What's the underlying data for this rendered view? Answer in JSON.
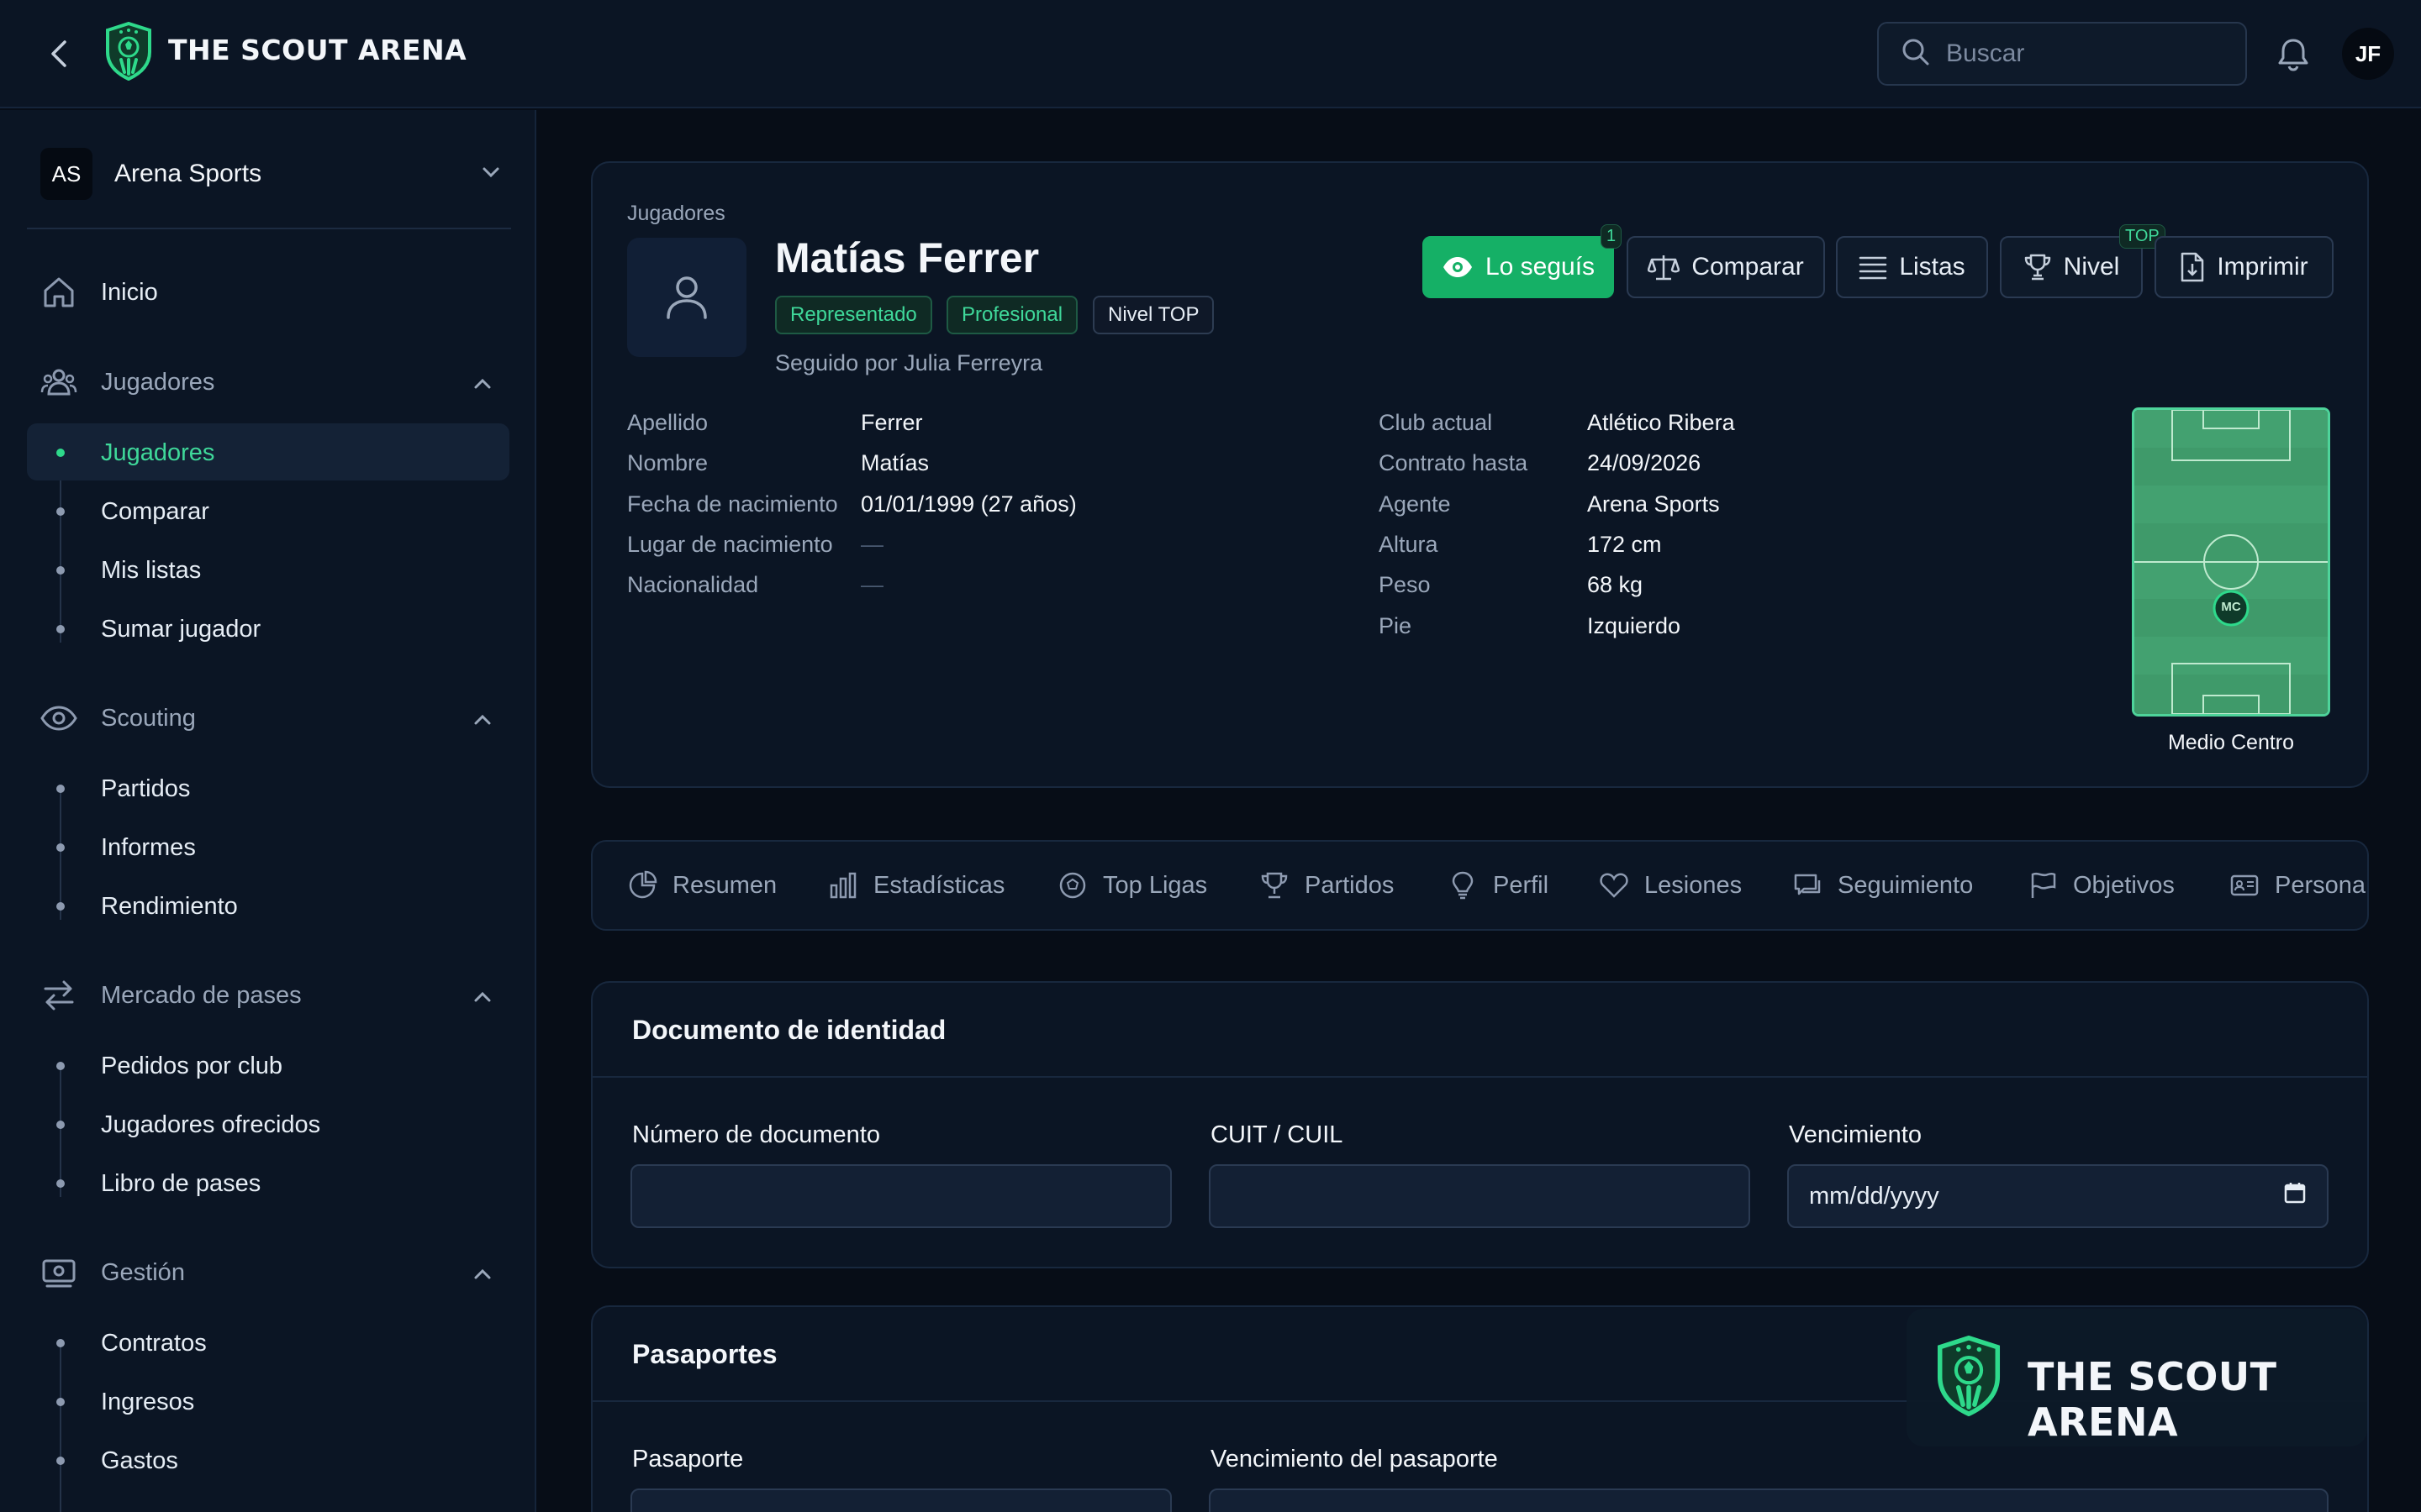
{
  "app": {
    "brand": "THE SCOUT ARENA"
  },
  "header": {
    "search_placeholder": "Buscar",
    "user_initials": "JF"
  },
  "sidebar": {
    "org": {
      "initials": "AS",
      "name": "Arena Sports"
    },
    "home": "Inicio",
    "sections": [
      {
        "label": "Jugadores",
        "items": [
          "Jugadores",
          "Comparar",
          "Mis listas",
          "Sumar jugador"
        ]
      },
      {
        "label": "Scouting",
        "items": [
          "Partidos",
          "Informes",
          "Rendimiento"
        ]
      },
      {
        "label": "Mercado de pases",
        "items": [
          "Pedidos por club",
          "Jugadores ofrecidos",
          "Libro de pases"
        ]
      },
      {
        "label": "Gestión",
        "items": [
          "Contratos",
          "Ingresos",
          "Gastos"
        ]
      }
    ],
    "active_item": "Jugadores"
  },
  "player": {
    "breadcrumb": "Jugadores",
    "name": "Matías Ferrer",
    "tags": [
      "Representado",
      "Profesional",
      "Nivel TOP"
    ],
    "followed_by": "Seguido por Julia Ferreyra",
    "actions": {
      "follow": "Lo seguís",
      "follow_count": "1",
      "compare": "Comparar",
      "lists": "Listas",
      "level": "Nivel",
      "level_badge": "TOP",
      "print": "Imprimir"
    },
    "left_fields": [
      {
        "label": "Apellido",
        "value": "Ferrer"
      },
      {
        "label": "Nombre",
        "value": "Matías"
      },
      {
        "label": "Fecha de nacimiento",
        "value": "01/01/1999 (27 años)"
      },
      {
        "label": "Lugar de nacimiento",
        "value": "—"
      },
      {
        "label": "Nacionalidad",
        "value": "—"
      }
    ],
    "right_fields": [
      {
        "label": "Club actual",
        "value": "Atlético Ribera"
      },
      {
        "label": "Contrato hasta",
        "value": "24/09/2026"
      },
      {
        "label": "Agente",
        "value": "Arena Sports"
      },
      {
        "label": "Altura",
        "value": "172 cm"
      },
      {
        "label": "Peso",
        "value": "68 kg"
      },
      {
        "label": "Pie",
        "value": "Izquierdo"
      }
    ],
    "position_code": "MC",
    "position_name": "Medio Centro"
  },
  "tabs": [
    "Resumen",
    "Estadísticas",
    "Top Ligas",
    "Partidos",
    "Perfil",
    "Lesiones",
    "Seguimiento",
    "Objetivos",
    "Persona"
  ],
  "identity": {
    "title": "Documento de identidad",
    "doc_label": "Número de documento",
    "cuit_label": "CUIT / CUIL",
    "expiry_label": "Vencimiento",
    "date_placeholder": "mm/dd/yyyy"
  },
  "passports": {
    "title": "Pasaportes",
    "passport_label": "Pasaporte",
    "expiry_label": "Vencimiento del pasaporte"
  },
  "colors": {
    "accent": "#15b066",
    "accent_text": "#3fd89a",
    "bg": "#070d17",
    "panel": "#0b1524"
  }
}
